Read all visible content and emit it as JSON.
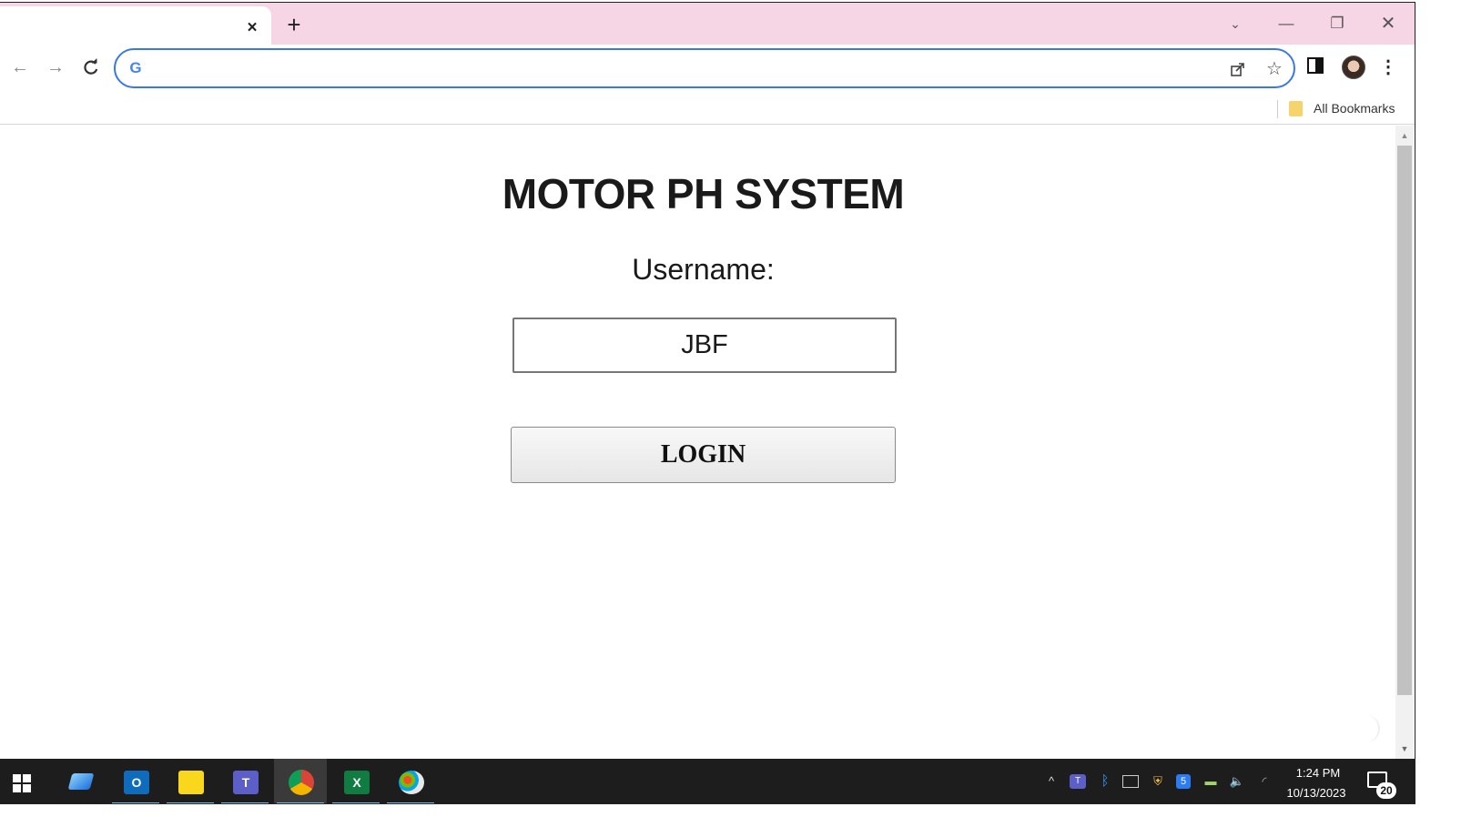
{
  "browser": {
    "tab_close_label": "×",
    "new_tab_label": "+",
    "window_controls": {
      "tab_search": "⌄",
      "minimize": "—",
      "restore": "❐",
      "close": "✕"
    },
    "toolbar": {
      "back": "←",
      "forward": "→",
      "reload": "C",
      "menu": "⋮"
    },
    "omnibox": {
      "value": "",
      "search_engine_glyph": "G",
      "icons": [
        "share-icon",
        "star-icon"
      ]
    },
    "bookmarks": {
      "all_bookmarks_label": "All Bookmarks"
    },
    "accent_color": "#3b78e7",
    "tabstrip_color": "#f6d6e4"
  },
  "page": {
    "title": "MOTOR PH SYSTEM",
    "username_label": "Username:",
    "username_value": "JBF",
    "login_label": "LOGIN"
  },
  "taskbar": {
    "apps": [
      {
        "name": "start-button"
      },
      {
        "name": "desktop-app-icon"
      },
      {
        "name": "outlook-icon",
        "glyph": "O"
      },
      {
        "name": "sticky-notes-icon"
      },
      {
        "name": "teams-icon",
        "glyph": "T"
      },
      {
        "name": "chrome-icon"
      },
      {
        "name": "excel-icon",
        "glyph": "X"
      },
      {
        "name": "paint-icon"
      }
    ],
    "clock": {
      "time": "1:24 PM",
      "date": "10/13/2023"
    },
    "notifications_count": "20"
  }
}
